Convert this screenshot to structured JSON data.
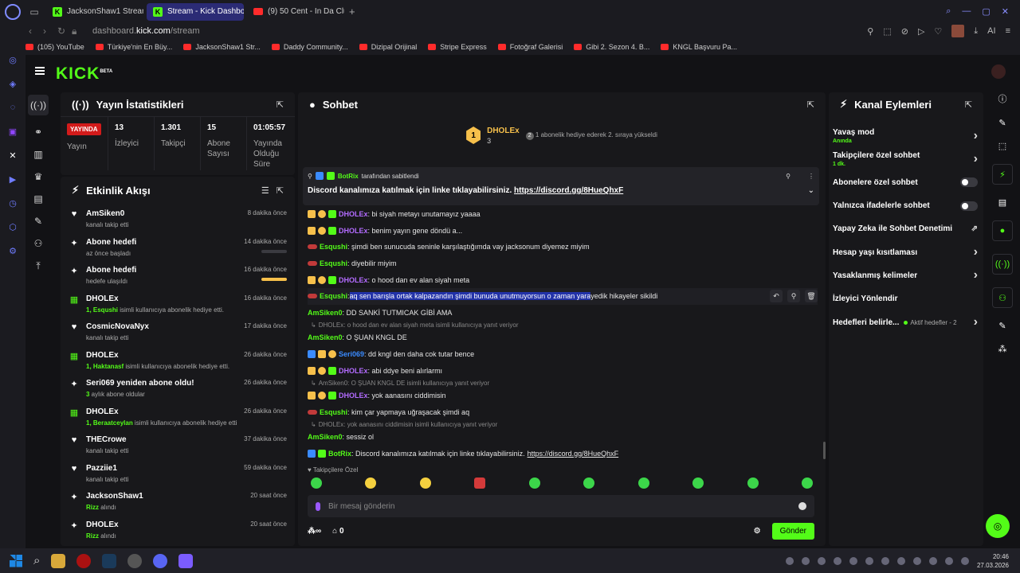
{
  "browser": {
    "tabs": [
      {
        "label": "JacksonShaw1 Stream - W",
        "type": "kick"
      },
      {
        "label": "Stream - Kick Dashboard",
        "type": "kick",
        "active": true
      },
      {
        "label": "(9) 50 Cent - In Da Club",
        "type": "youtube"
      }
    ],
    "url_prefix": "dashboard.",
    "url_host": "kick.com",
    "url_path": "/stream",
    "bookmarks": [
      "(105) YouTube",
      "Türkiye'nin En Büy...",
      "JacksonShaw1 Str...",
      "Daddy Community...",
      "Dizipal Orijinal",
      "Stripe Express",
      "Fotoğraf Galerisi",
      "Gibi 2. Sezon 4. B...",
      "KNGL Başvuru Pa..."
    ],
    "ai_label": "AI"
  },
  "app": {
    "logo": "KICK",
    "logo_beta": "BETA"
  },
  "stats": {
    "title": "Yayın İstatistikleri",
    "live_badge": "YAYINDA",
    "live_label": "Yayın",
    "items": [
      {
        "value": "13",
        "label": "İzleyici"
      },
      {
        "value": "1.301",
        "label": "Takipçi"
      },
      {
        "value": "15",
        "label": "Abone Sayısı"
      },
      {
        "value": "01:05:57",
        "label": "Yayında Olduğu Süre"
      }
    ]
  },
  "activity": {
    "title": "Etkinlik Akışı",
    "events": [
      {
        "icon": "heart-icon",
        "name": "AmSiken0",
        "sub": "kanalı takip etti",
        "time": "8 dakika önce"
      },
      {
        "icon": "sparkle-icon",
        "name": "Abone hedefi",
        "sub": "az önce başladı",
        "time": "14 dakika önce",
        "bar": 0.0
      },
      {
        "icon": "sparkle-icon",
        "name": "Abone hedefi",
        "sub": "hedefe ulaşıldı",
        "time": "16 dakika önce",
        "bar": 1.0
      },
      {
        "icon": "gift-icon",
        "name": "DHOLEx",
        "hl": "1, Esqushi",
        "sub": " isimli kullanıcıya abonelik hediye etti.",
        "time": "16 dakika önce"
      },
      {
        "icon": "heart-icon",
        "name": "CosmicNovaNyx",
        "sub": "kanalı takip etti",
        "time": "17 dakika önce"
      },
      {
        "icon": "gift-icon",
        "name": "DHOLEx",
        "hl": "1, Haktanasf",
        "sub": " isimli kullanıcıya abonelik hediye etti.",
        "time": "26 dakika önce"
      },
      {
        "icon": "sparkle-icon",
        "name": "Seri069 yeniden abone oldu!",
        "hl": "3",
        "sub": " aylık abone oldular",
        "time": "26 dakika önce"
      },
      {
        "icon": "gift-icon",
        "name": "DHOLEx",
        "hl": "1, Beraatceylan",
        "sub": " isimli kullanıcıya abonelik hediye etti.",
        "time": "26 dakika önce"
      },
      {
        "icon": "heart-icon",
        "name": "THECrowe",
        "sub": "kanalı takip etti",
        "time": "37 dakika önce"
      },
      {
        "icon": "heart-icon",
        "name": "Pazziie1",
        "sub": "kanalı takip etti",
        "time": "59 dakika önce"
      },
      {
        "icon": "sparkle-icon",
        "name": "JacksonShaw1",
        "hl": "Rizz",
        "sub": " alındı",
        "time": "20 saat önce"
      },
      {
        "icon": "sparkle-icon",
        "name": "DHOLEx",
        "hl": "Rizz",
        "sub": " alındı",
        "time": "20 saat önce"
      }
    ]
  },
  "chat": {
    "title": "Sohbet",
    "goal_user": "DHOLEx",
    "goal_count": "3",
    "goal_badge": "1",
    "goal_text": "1 abonelik hediye ederek 2. sıraya yükseldi",
    "goal_num": "2",
    "pinned_by": "BotRix",
    "pinned_by_suffix": " tarafından sabitlendi",
    "pinned_text": "Discord kanalımıza katılmak için linke tıklayabilirsiniz. ",
    "pinned_link": "https://discord.gg/8HueQhxF",
    "messages": [
      {
        "badges": [
          "crown",
          "one",
          "sub"
        ],
        "user": "DHOLEx",
        "color": "purple",
        "text": ": bi siyah metayı unutamayız yaaaa"
      },
      {
        "badges": [
          "crown",
          "one",
          "sub"
        ],
        "user": "DHOLEx",
        "color": "purple",
        "text": ": benim yayın gene döndü a..."
      },
      {
        "badges": [
          "red"
        ],
        "user": "Esqushi",
        "color": "green",
        "text": ": şimdi ben sunucuda seninle karşılaştığımda vay jacksonum diyemez miyim"
      },
      {
        "badges": [
          "red"
        ],
        "user": "Esqushi",
        "color": "green",
        "text": ": diyebilir miyim"
      },
      {
        "badges": [
          "crown",
          "one",
          "sub"
        ],
        "user": "DHOLEx",
        "color": "purple",
        "text": ": o hood dan ev alan siyah meta"
      },
      {
        "badges": [
          "red"
        ],
        "user": "Esqushi",
        "color": "green",
        "text": ": ",
        "highlight": "aq sen barışla ortak kalpazandın şimdi bunuda unutmuyorsun o zaman yara",
        "after": " yedik hikayeler sikildi",
        "hover": true
      },
      {
        "badges": [],
        "user": "AmSiken0",
        "color": "green",
        "text": ": DD SANKİ TUTMICAK GİBİ AMA"
      },
      {
        "reply": "DHOLEx: o hood dan ev alan siyah meta isimli kullanıcıya yanıt veriyor"
      },
      {
        "badges": [],
        "user": "AmSiken0",
        "color": "green",
        "text": ": O ŞUAN KNGL DE"
      },
      {
        "badges": [
          "blue",
          "crown",
          "one"
        ],
        "user": "Seri069",
        "color": "blue",
        "text": ": dd kngl den daha cok tutar bence"
      },
      {
        "badges": [
          "crown",
          "one",
          "sub"
        ],
        "user": "DHOLEx",
        "color": "purple",
        "text": ": abi ddye beni alırlarmı"
      },
      {
        "reply": "AmSiken0: O ŞUAN KNGL DE isimli kullanıcıya yanıt veriyor"
      },
      {
        "badges": [
          "crown",
          "one",
          "sub"
        ],
        "user": "DHOLEx",
        "color": "purple",
        "text": ": yok aanasını ciddimisin"
      },
      {
        "badges": [
          "red"
        ],
        "user": "Esqushi",
        "color": "green",
        "text": ": kim çar yapmaya uğraşacak şimdi aq"
      },
      {
        "reply": "DHOLEx: yok aanasını ciddimisin isimli kullanıcıya yanıt veriyor"
      },
      {
        "badges": [],
        "user": "AmSiken0",
        "color": "green",
        "text": ": sessiz ol"
      },
      {
        "badges": [
          "blue",
          "sub"
        ],
        "user": "BotRix",
        "color": "green",
        "text": ": Discord kanalımıza katılmak için linke tıklayabilirsiniz. ",
        "link": "https://discord.gg/8HueQhxF"
      }
    ],
    "followers_only": "Takipçilere Özel",
    "placeholder": "Bir mesaj gönderin",
    "points": "0",
    "send": "Gönder"
  },
  "actions": {
    "title": "Kanal Eylemleri",
    "items": [
      {
        "label": "Yavaş mod",
        "sub": "Anında",
        "ctl": "chevron"
      },
      {
        "label": "Takipçilere özel sohbet",
        "sub": "1 dk.",
        "ctl": "chevron"
      },
      {
        "label": "Abonelere özel sohbet",
        "ctl": "toggle"
      },
      {
        "label": "Yalnızca ifadelerle sohbet",
        "ctl": "toggle"
      },
      {
        "label": "Yapay Zeka ile Sohbet Denetimi",
        "ctl": "ext"
      },
      {
        "label": "Hesap yaşı kısıtlaması",
        "ctl": "chevron"
      },
      {
        "label": "Yasaklanmış kelimeler",
        "ctl": "chevron"
      },
      {
        "label": "İzleyici Yönlendir",
        "ctl": "none"
      },
      {
        "label": "Hedefleri belirle...",
        "ctl": "chevron",
        "aktif": "Aktif hedefler - 2"
      }
    ]
  },
  "taskbar": {
    "time": "20:46",
    "date": "27.03.2026"
  }
}
